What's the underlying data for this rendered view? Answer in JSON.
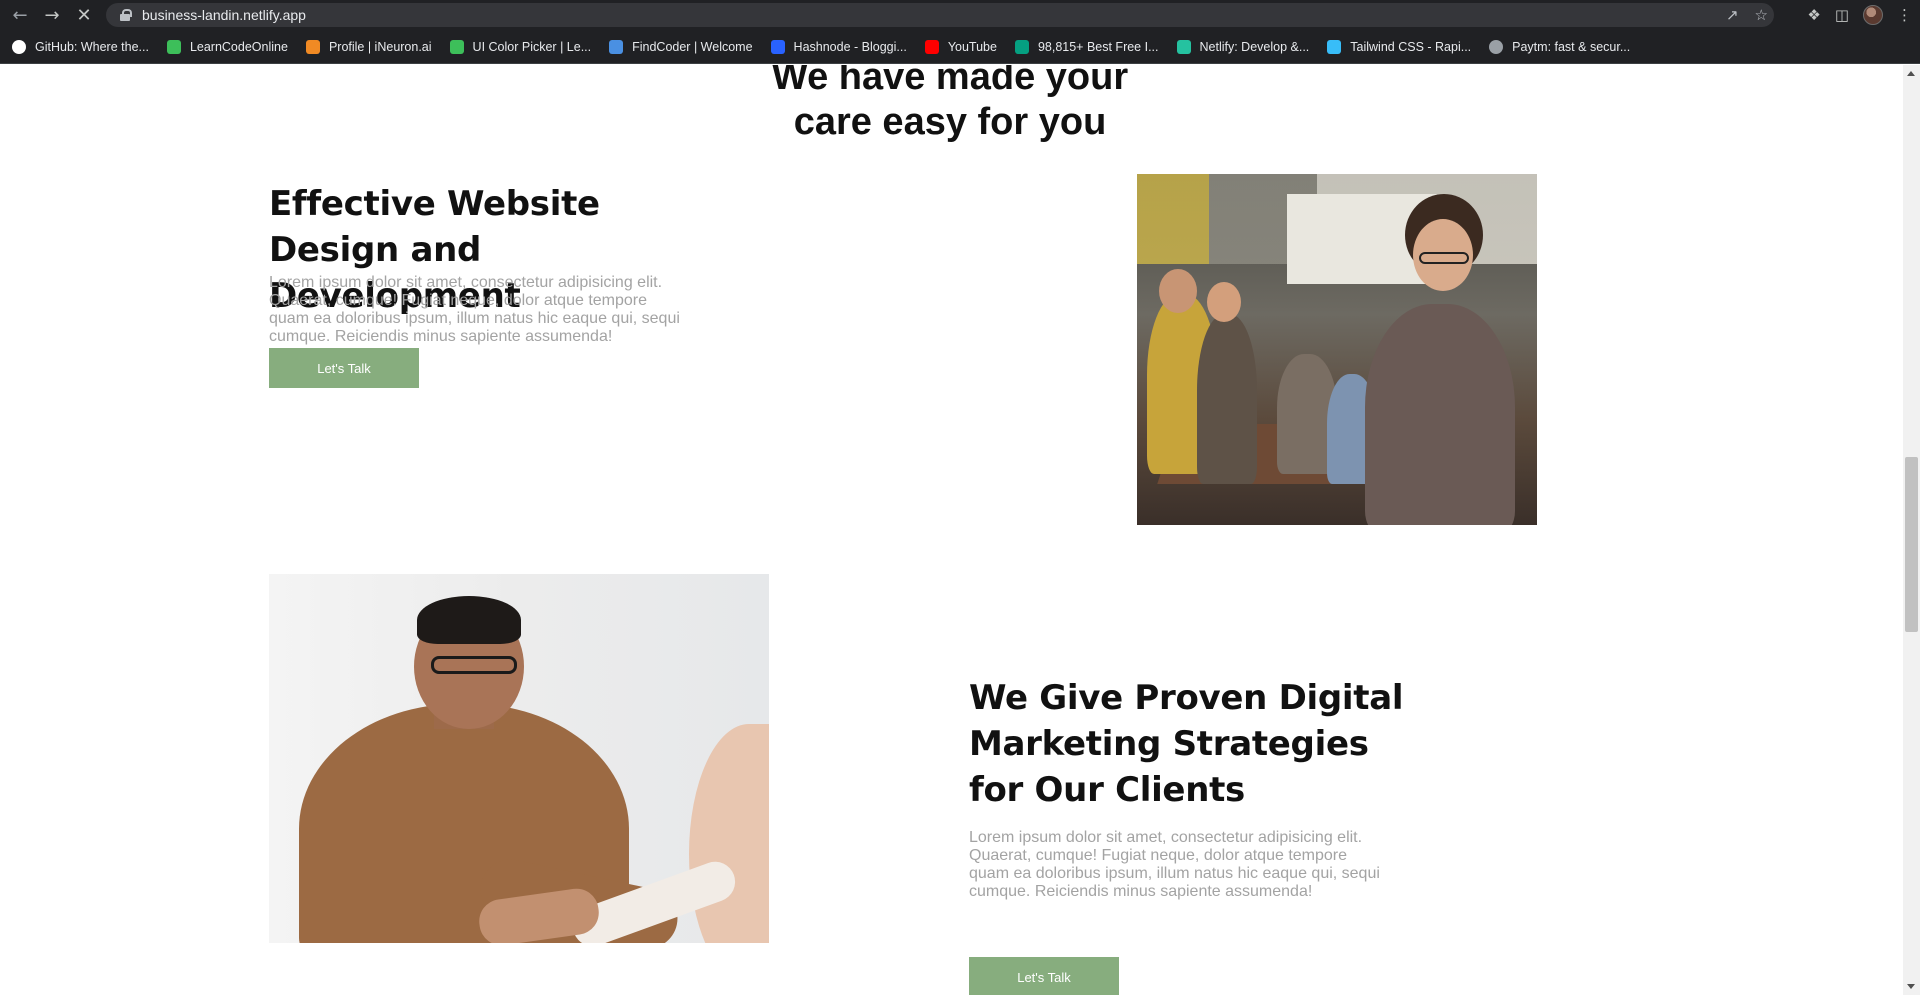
{
  "browser": {
    "url": "business-landin.netlify.app",
    "bookmarks": [
      {
        "label": "GitHub: Where the...",
        "icon": "github-icon",
        "color": "#ffffff"
      },
      {
        "label": "LearnCodeOnline",
        "icon": "learncodeonline-icon",
        "color": "#3dbf5a"
      },
      {
        "label": "Profile | iNeuron.ai",
        "icon": "ineuron-icon",
        "color": "#f08a24"
      },
      {
        "label": "UI Color Picker | Le...",
        "icon": "learncodeonline-icon",
        "color": "#3dbf5a"
      },
      {
        "label": "FindCoder | Welcome",
        "icon": "code-icon",
        "color": "#4a90e2"
      },
      {
        "label": "Hashnode - Bloggi...",
        "icon": "hashnode-icon",
        "color": "#2962ff"
      },
      {
        "label": "YouTube",
        "icon": "youtube-icon",
        "color": "#ff0000"
      },
      {
        "label": "98,815+ Best Free I...",
        "icon": "pexels-icon",
        "color": "#05a081"
      },
      {
        "label": "Netlify: Develop &...",
        "icon": "netlify-icon",
        "color": "#25c2a0"
      },
      {
        "label": "Tailwind CSS - Rapi...",
        "icon": "tailwind-icon",
        "color": "#38bdf8"
      },
      {
        "label": "Paytm: fast & secur...",
        "icon": "globe-icon",
        "color": "#9aa0a6"
      }
    ]
  },
  "page": {
    "section_title": "We have made your care easy for you",
    "features": [
      {
        "heading": "Effective Website Design and Development",
        "text": "Lorem ipsum dolor sit amet, consectetur adipisicing elit. Quaerat, cumque! Fugiat neque, dolor atque tempore quam ea doloribus ipsum, illum natus hic eaque qui, sequi cumque. Reiciendis minus sapiente assumenda!",
        "cta": "Let's Talk"
      },
      {
        "heading": "We Give Proven Digital Marketing Strategies for Our Clients",
        "text": "Lorem ipsum dolor sit amet, consectetur adipisicing elit. Quaerat, cumque! Fugiat neque, dolor atque tempore quam ea doloribus ipsum, illum natus hic eaque qui, sequi cumque. Reiciendis minus sapiente assumenda!",
        "cta": "Let's Talk"
      }
    ]
  },
  "colors": {
    "cta_background": "#87ad7e",
    "body_text": "#a3a3a3",
    "heading": "#111111"
  }
}
